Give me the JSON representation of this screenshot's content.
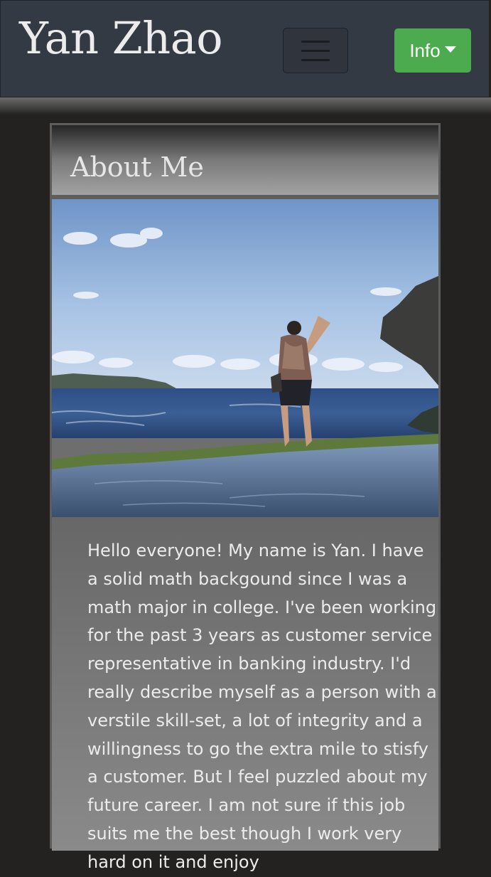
{
  "navbar": {
    "brand": "Yan Zhao",
    "toggler_icon": "hamburger-menu-icon",
    "info_label": "Info",
    "info_caret_icon": "caret-down-icon",
    "brand_color": "#ececec",
    "info_color": "#4caa4f"
  },
  "card": {
    "title": "About Me",
    "photo_icon": "profile-photo",
    "bio": "Hello everyone! My name is Yan. I have a solid math backgound since I was a math major in college. I've been working for the past 3 years as customer service representative in banking industry. I'd really describe myself as a person with a verstile skill-set, a lot of integrity and a willingness to go the extra mile to stisfy a customer. But I feel puzzled about my future career. I am not sure if this job suits me the best though I work very hard on it and enjoy"
  }
}
